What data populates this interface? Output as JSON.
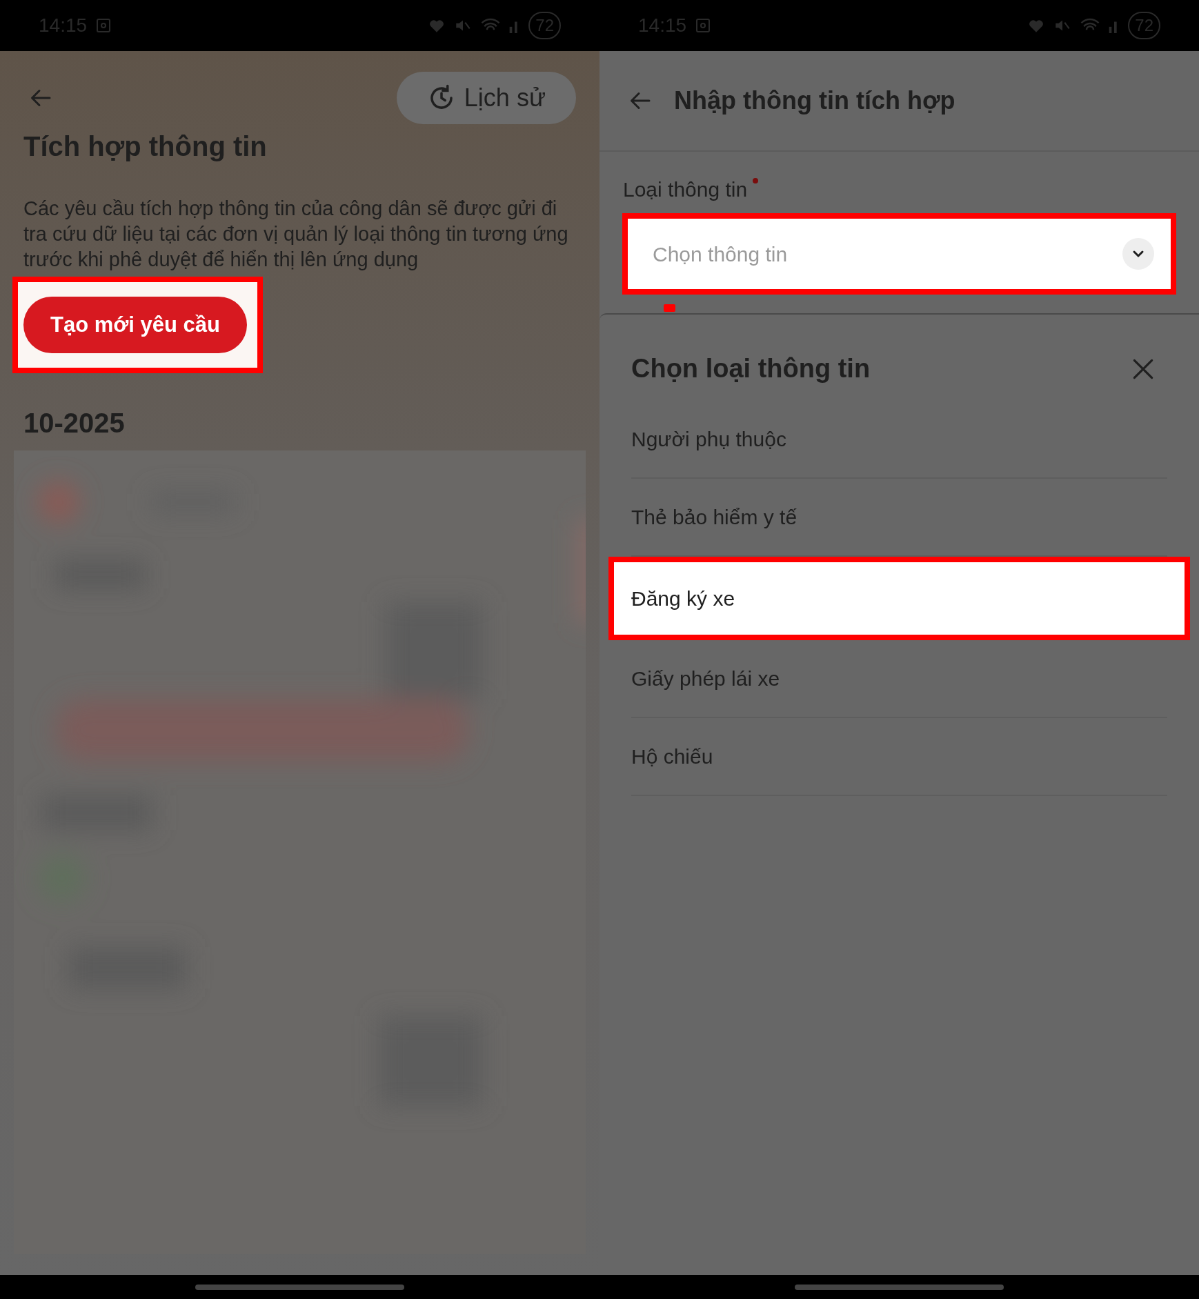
{
  "status_bars": [
    {
      "time": "14:15",
      "battery": "72"
    },
    {
      "time": "14:15",
      "battery": "72"
    }
  ],
  "left_screen": {
    "history_button": "Lịch sử",
    "title": "Tích hợp thông tin",
    "description": "Các yêu cầu tích hợp thông tin của công dân sẽ được gửi đi tra cứu dữ liệu tại các đơn vị quản lý loại thông tin tương ứng trước khi phê duyệt để hiển thị lên ứng dụng",
    "create_button": {
      "label": "Tạo mới yêu cầu",
      "highlighted": true
    },
    "month_heading": "10-2025"
  },
  "right_screen": {
    "title": "Nhập thông tin tích hợp",
    "field_label": "Loại thông tin",
    "required": true,
    "select_field": {
      "placeholder": "Chọn thông tin",
      "highlighted": true
    },
    "sheet": {
      "title": "Chọn loại thông tin",
      "options": [
        {
          "label": "Người phụ thuộc",
          "highlighted": false
        },
        {
          "label": "Thẻ bảo hiểm y tế",
          "highlighted": false
        },
        {
          "label": "Đăng ký xe",
          "highlighted": true
        },
        {
          "label": "Giấy phép lái xe",
          "highlighted": false
        },
        {
          "label": "Hộ chiếu",
          "highlighted": false
        }
      ]
    }
  }
}
